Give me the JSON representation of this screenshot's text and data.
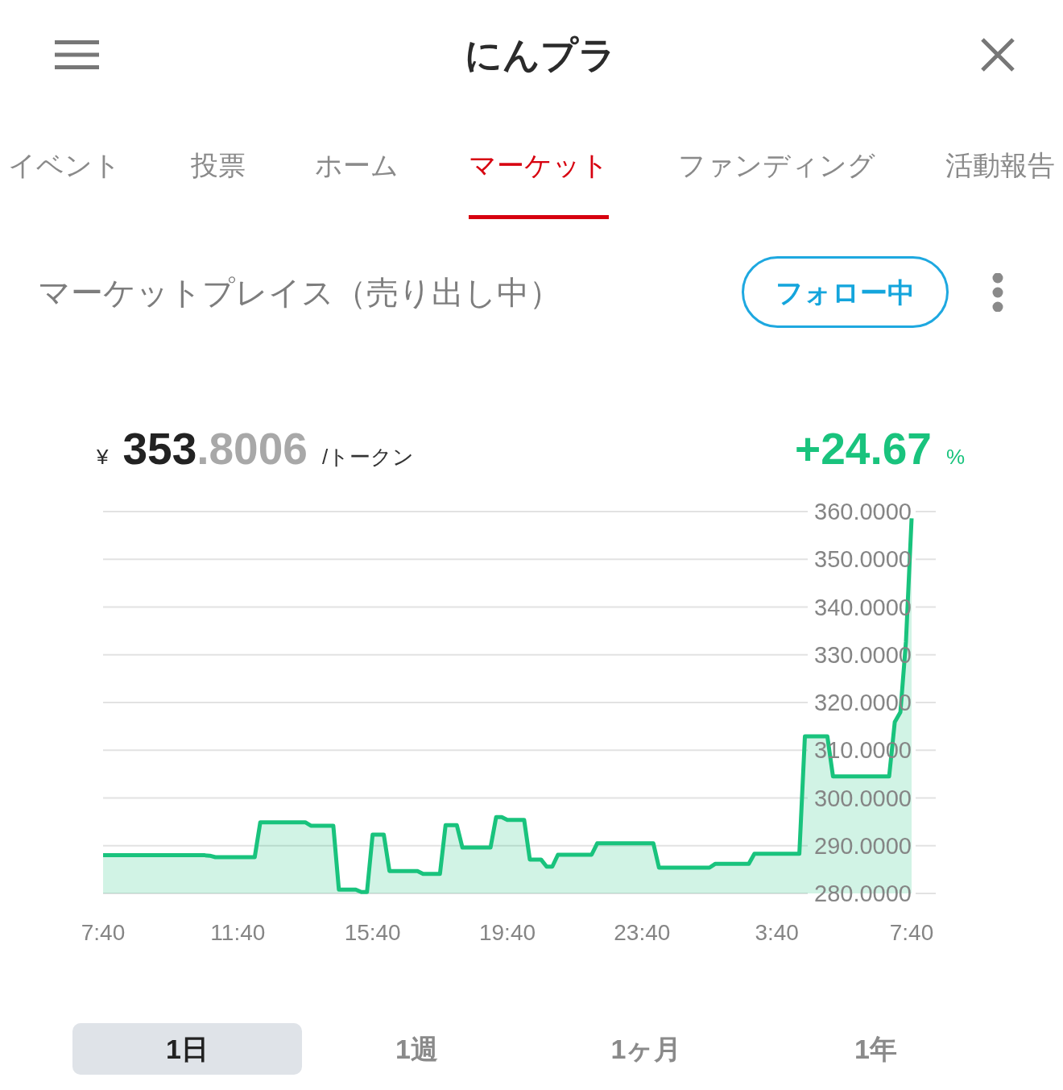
{
  "header": {
    "title": "にんプラ"
  },
  "tabs": [
    {
      "label": "イベント",
      "selected": false
    },
    {
      "label": "投票",
      "selected": false
    },
    {
      "label": "ホーム",
      "selected": false
    },
    {
      "label": "マーケット",
      "selected": true
    },
    {
      "label": "ファンディング",
      "selected": false
    },
    {
      "label": "活動報告",
      "selected": false
    }
  ],
  "section": {
    "title": "マーケットプレイス（売り出し中）",
    "follow_button": {
      "label": "フォロー中"
    }
  },
  "price": {
    "currency": "¥",
    "whole": "353",
    "fraction": ".8006",
    "unit": "/トークン",
    "change": "+24.67",
    "change_unit": "%"
  },
  "chart": {
    "chart_data": {
      "type": "area",
      "grid": true,
      "categories": [
        "7:40",
        null,
        null,
        null,
        null,
        null,
        null,
        null,
        null,
        null,
        null,
        null,
        null,
        null,
        null,
        null,
        null,
        null,
        null,
        null,
        null,
        null,
        null,
        null,
        "11:40",
        null,
        null,
        null,
        null,
        null,
        null,
        null,
        null,
        null,
        null,
        null,
        null,
        null,
        null,
        null,
        null,
        null,
        null,
        null,
        null,
        null,
        null,
        null,
        "15:40",
        null,
        null,
        null,
        null,
        null,
        null,
        null,
        null,
        null,
        null,
        null,
        null,
        null,
        null,
        null,
        null,
        null,
        null,
        null,
        null,
        null,
        null,
        null,
        "19:40",
        null,
        null,
        null,
        null,
        null,
        null,
        null,
        null,
        null,
        null,
        null,
        null,
        null,
        null,
        null,
        null,
        null,
        null,
        null,
        null,
        null,
        null,
        null,
        "23:40",
        null,
        null,
        null,
        null,
        null,
        null,
        null,
        null,
        null,
        null,
        null,
        null,
        null,
        null,
        null,
        null,
        null,
        null,
        null,
        null,
        null,
        null,
        null,
        "3:40",
        null,
        null,
        null,
        null,
        null,
        null,
        null,
        null,
        null,
        null,
        null,
        null,
        null,
        null,
        null,
        null,
        null,
        null,
        null,
        null,
        null,
        null,
        null,
        "7:40"
      ],
      "series": [
        {
          "color": "#19c37d",
          "values": [
            288,
            288,
            288,
            288,
            288,
            288,
            288,
            288,
            288,
            288,
            288,
            288,
            288,
            288,
            288,
            288,
            288,
            288,
            288,
            287.9,
            287.6,
            287.6,
            287.6,
            287.6,
            287.6,
            287.6,
            287.6,
            287.6,
            294.9,
            294.9,
            294.9,
            294.9,
            294.9,
            294.9,
            294.9,
            294.9,
            294.9,
            294.2,
            294.2,
            294.2,
            294.2,
            294.2,
            280.8,
            280.8,
            280.8,
            280.8,
            280.3,
            280.3,
            292.3,
            292.3,
            292.3,
            284.7,
            284.7,
            284.7,
            284.7,
            284.7,
            284.7,
            284.1,
            284.1,
            284.1,
            284.1,
            294.3,
            294.3,
            294.3,
            289.6,
            289.6,
            289.6,
            289.6,
            289.6,
            289.6,
            296,
            296,
            295.4,
            295.4,
            295.4,
            295.4,
            287.1,
            287.1,
            287.1,
            285.6,
            285.6,
            288.1,
            288.1,
            288.1,
            288.1,
            288.1,
            288.1,
            288.1,
            290.5,
            290.5,
            290.5,
            290.5,
            290.5,
            290.5,
            290.5,
            290.5,
            290.5,
            290.5,
            290.5,
            285.4,
            285.4,
            285.4,
            285.4,
            285.4,
            285.4,
            285.4,
            285.4,
            285.4,
            285.4,
            286.2,
            286.2,
            286.2,
            286.2,
            286.2,
            286.2,
            286.2,
            288.3,
            288.3,
            288.3,
            288.3,
            288.3,
            288.3,
            288.3,
            288.3,
            288.3,
            312.9,
            312.9,
            312.9,
            312.9,
            312.9,
            304.5,
            304.5,
            304.5,
            304.5,
            304.5,
            304.5,
            304.5,
            304.5,
            304.5,
            304.5,
            304.5,
            315.9,
            318,
            332.8,
            358.6
          ]
        }
      ],
      "ylim": [
        280,
        360
      ],
      "yticks": [
        {
          "value": 360,
          "label": "360.0000"
        },
        {
          "value": 350,
          "label": "350.0000"
        },
        {
          "value": 340,
          "label": "340.0000"
        },
        {
          "value": 330,
          "label": "330.0000"
        },
        {
          "value": 320,
          "label": "320.0000"
        },
        {
          "value": 310,
          "label": "310.0000"
        },
        {
          "value": 300,
          "label": "300.0000"
        },
        {
          "value": 290,
          "label": "290.0000"
        },
        {
          "value": 280,
          "label": "280.0000"
        }
      ]
    }
  },
  "periods": [
    {
      "label": "1日",
      "selected": true
    },
    {
      "label": "1週",
      "selected": false
    },
    {
      "label": "1ヶ月",
      "selected": false
    },
    {
      "label": "1年",
      "selected": false
    }
  ]
}
